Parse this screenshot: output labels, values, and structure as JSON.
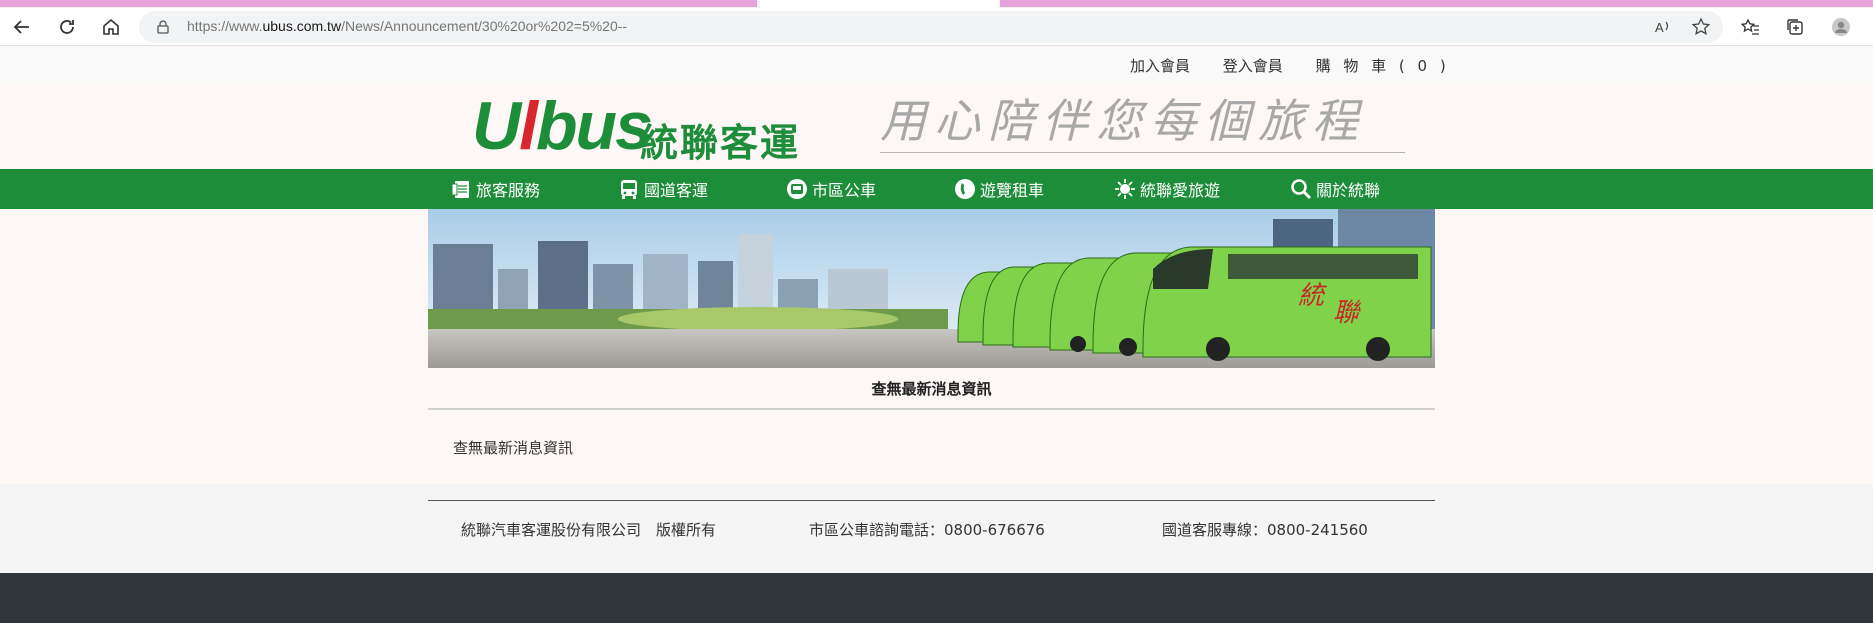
{
  "browser": {
    "url_prefix": "https://www.",
    "url_host": "ubus.com.tw",
    "url_path": "/News/Announcement/30%20or%202=5%20--"
  },
  "header": {
    "links": [
      "加入會員",
      "登入會員",
      "購 物 車 ( 0 )"
    ],
    "logo_text": "統聯客運",
    "slogan": "用心陪伴您每個旅程"
  },
  "nav": {
    "items": [
      {
        "label": "旅客服務",
        "icon": "passenger-service-icon"
      },
      {
        "label": "國道客運",
        "icon": "bus-icon"
      },
      {
        "label": "市區公車",
        "icon": "city-bus-icon"
      },
      {
        "label": "遊覽租車",
        "icon": "phone-icon"
      },
      {
        "label": "統聯愛旅遊",
        "icon": "sun-icon"
      },
      {
        "label": "關於統聯",
        "icon": "search-icon"
      }
    ]
  },
  "main": {
    "title": "查無最新消息資訊",
    "body": "查無最新消息資訊"
  },
  "footer": {
    "company": "統聯汽車客運股份有限公司　版權所有",
    "city_bus_phone": "市區公車諮詢電話：0800-676676",
    "highway_phone": "國道客服專線：0800-241560"
  },
  "colors": {
    "brand_green": "#1d8d3a",
    "brand_red": "#d7262d",
    "footer_dark": "#31353c"
  }
}
